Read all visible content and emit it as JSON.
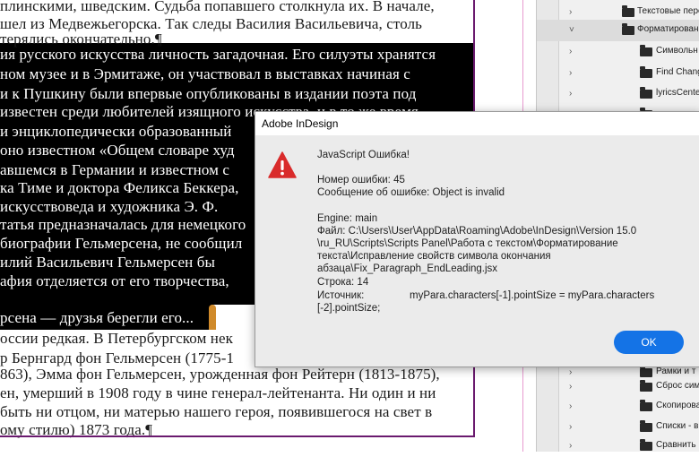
{
  "document": {
    "lines_top": [
      "плинскими, шведским. Судьба попавшего столкнула их. В начале,",
      "шел из Медвежьегорска. Так следы Василия Васильевича, столь",
      "терялись окончательно.¶"
    ],
    "lines_selected": [
      "ия русского искусства личность загадочная. Его силуэты хранятся",
      "ном музее и в Эрмитаже, он участвовал в выставках начиная с",
      "и к Пушкину были впервые опубликованы в издании поэта под",
      "известен среди любителей изящного искусства, и в то же время",
      "и энциклопедически образованный",
      "оно известном «Общем словаре худ",
      "авшемся в Германии и известном с",
      "ка Тиме и доктора Феликса Беккера,",
      "искусствоведа и художника Э. Ф.",
      "татья предназначалась для немецкого",
      "биографии Гельмерсена, не сообщил",
      "илий Васильевич Гельмерсен бы",
      "афия отделяется от его творчества,"
    ],
    "line_tail": "рсена — друзья берегли его...",
    "lines_bottom": [
      "оссии редкая. В Петербургском нек",
      "р Бернгард фон Гельмерсен (1775-1",
      "863), Эмма фон Гельмерсен, урожденная фон Рейтерн (1813-1875),",
      "ен, умерший в 1908 году в чине генерал-лейтенанта. Ни один и ни",
      "быть ни отцом, ни матерью нашего героя, появившегося на свет в",
      "ому стилю) 1873 года.¶"
    ]
  },
  "scripts_panel": {
    "items": [
      {
        "label": "Текстовые перем",
        "indent": 1,
        "expanded": false
      },
      {
        "label": "Форматирование",
        "indent": 1,
        "expanded": true,
        "selected": true
      },
      {
        "label": "Символьн",
        "indent": 2,
        "expanded": false
      },
      {
        "label": "Find Chang",
        "indent": 2,
        "expanded": false
      },
      {
        "label": "lyricsCente",
        "indent": 2,
        "expanded": false
      },
      {
        "label": "",
        "indent": 2,
        "expanded": false
      },
      {
        "label": "Рамки и т",
        "indent": 1,
        "expanded": false
      },
      {
        "label": "Сброс сим",
        "indent": 1,
        "expanded": false
      },
      {
        "label": "Скопирова",
        "indent": 1,
        "expanded": false
      },
      {
        "label": "Списки - в",
        "indent": 1,
        "expanded": false
      },
      {
        "label": "Сравнить",
        "indent": 1,
        "expanded": false
      }
    ]
  },
  "dialog": {
    "title": "Adobe InDesign",
    "heading": "JavaScript Ошибка!",
    "error_number_line": "Номер ошибки: 45",
    "error_message_line": "Сообщение об ошибке: Object is invalid",
    "engine_line": "Engine: main",
    "file_lines": [
      "Файл: C:\\Users\\User\\AppData\\Roaming\\Adobe\\InDesign\\Version 15.0",
      "\\ru_RU\\Scripts\\Scripts Panel\\Работа с текстом\\Форматирование",
      "текста\\Исправление свойств символа окончания",
      "абзаца\\Fix_Paragraph_EndLeading.jsx"
    ],
    "line_line": "Строка: 14",
    "source_label": "Источник:",
    "source_value_1": "myPara.characters[-1].pointSize = myPara.characters",
    "source_value_2": "[-2].pointSize;",
    "ok_label": "OK",
    "icon": "error-icon",
    "accent_color": "#1473e6",
    "icon_color": "#d92b2b"
  }
}
